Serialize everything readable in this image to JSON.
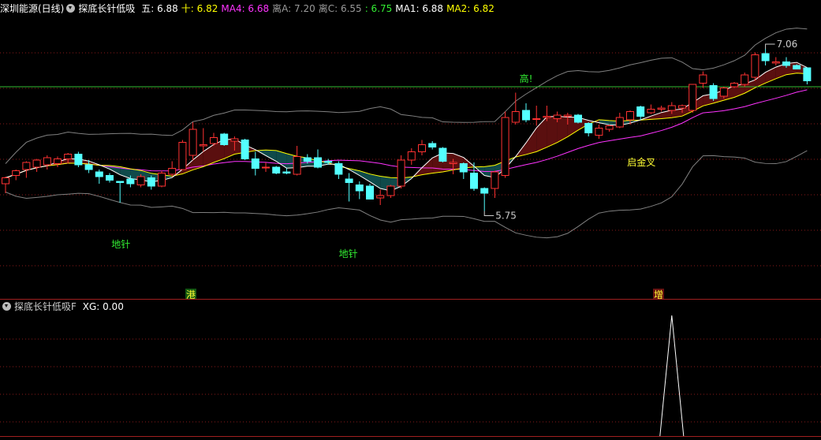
{
  "top_header": {
    "stock_title": "深圳能源(日线)",
    "indicator_name": "探底长针低吸",
    "items": [
      {
        "label": "五:",
        "value": "6.88",
        "color": "#ffffff"
      },
      {
        "label": "十:",
        "value": "6.82",
        "color": "#ffff00"
      },
      {
        "label": "MA4:",
        "value": "6.68",
        "color": "#ff33ff"
      },
      {
        "label": "离A:",
        "value": "7.20",
        "color": "#9a9a9a"
      },
      {
        "label": "离C:",
        "value": "6.55",
        "color": "#9a9a9a"
      },
      {
        "label": ":",
        "value": "6.75",
        "color": "#33ee33"
      },
      {
        "label": "MA1:",
        "value": "6.88",
        "color": "#ffffff"
      },
      {
        "label": "MA2:",
        "value": "6.82",
        "color": "#ffff00"
      }
    ]
  },
  "bottom_header": {
    "indicator_name": "探底长针低吸F",
    "items": [
      {
        "label": "XG:",
        "value": "0.00",
        "color": "#ffffff"
      }
    ]
  },
  "annotations": {
    "high_label": "高!",
    "low_signal_1": "地针",
    "low_signal_2": "地针",
    "golden_cross": "启金叉",
    "price_high": "7.06",
    "price_low": "5.75",
    "badge_1": "港",
    "badge_2": "增"
  },
  "colors": {
    "up": "#ff3232",
    "down": "#54ffff",
    "ma_white": "#ffffff",
    "ma_yellow": "#ffff00",
    "ma_magenta": "#ff33ff",
    "band": "#808080",
    "resistance": "#33bb33",
    "grid": "#8a1a1a",
    "ribbon_bear": "#5a0f0f",
    "ribbon_bull": "#0f4a4a"
  },
  "chart_data": {
    "type": "candlestick",
    "y_range": [
      5.0,
      7.3
    ],
    "resistance_level": 6.7,
    "candles": [
      {
        "o": 5.88,
        "h": 5.94,
        "l": 5.8,
        "c": 5.93
      },
      {
        "o": 5.95,
        "h": 6.0,
        "l": 5.91,
        "c": 5.99
      },
      {
        "o": 6.0,
        "h": 6.07,
        "l": 5.93,
        "c": 6.06
      },
      {
        "o": 6.02,
        "h": 6.09,
        "l": 5.98,
        "c": 6.08
      },
      {
        "o": 6.04,
        "h": 6.12,
        "l": 6.0,
        "c": 6.1
      },
      {
        "o": 6.05,
        "h": 6.11,
        "l": 6.02,
        "c": 6.09
      },
      {
        "o": 6.09,
        "h": 6.14,
        "l": 6.05,
        "c": 6.13
      },
      {
        "o": 6.13,
        "h": 6.15,
        "l": 6.02,
        "c": 6.04
      },
      {
        "o": 6.04,
        "h": 6.08,
        "l": 5.97,
        "c": 6.0
      },
      {
        "o": 5.98,
        "h": 6.0,
        "l": 5.88,
        "c": 5.94
      },
      {
        "o": 5.95,
        "h": 5.97,
        "l": 5.89,
        "c": 5.91
      },
      {
        "o": 5.9,
        "h": 5.9,
        "l": 5.72,
        "c": 5.89
      },
      {
        "o": 5.92,
        "h": 5.95,
        "l": 5.85,
        "c": 5.88
      },
      {
        "o": 5.87,
        "h": 5.96,
        "l": 5.85,
        "c": 5.94
      },
      {
        "o": 5.93,
        "h": 5.95,
        "l": 5.83,
        "c": 5.86
      },
      {
        "o": 5.86,
        "h": 5.99,
        "l": 5.85,
        "c": 5.97
      },
      {
        "o": 5.96,
        "h": 6.07,
        "l": 5.94,
        "c": 6.01
      },
      {
        "o": 6.0,
        "h": 6.25,
        "l": 6.0,
        "c": 6.23
      },
      {
        "o": 6.12,
        "h": 6.4,
        "l": 6.08,
        "c": 6.34
      },
      {
        "o": 6.2,
        "h": 6.35,
        "l": 6.15,
        "c": 6.21
      },
      {
        "o": 6.22,
        "h": 6.31,
        "l": 6.2,
        "c": 6.27
      },
      {
        "o": 6.3,
        "h": 6.31,
        "l": 6.2,
        "c": 6.21
      },
      {
        "o": 6.24,
        "h": 6.28,
        "l": 6.16,
        "c": 6.26
      },
      {
        "o": 6.25,
        "h": 6.26,
        "l": 6.08,
        "c": 6.09
      },
      {
        "o": 6.09,
        "h": 6.15,
        "l": 5.95,
        "c": 6.01
      },
      {
        "o": 6.02,
        "h": 6.06,
        "l": 5.98,
        "c": 6.02
      },
      {
        "o": 6.02,
        "h": 6.03,
        "l": 5.96,
        "c": 5.97
      },
      {
        "o": 5.98,
        "h": 6.01,
        "l": 5.96,
        "c": 5.97
      },
      {
        "o": 5.96,
        "h": 6.2,
        "l": 5.95,
        "c": 6.11
      },
      {
        "o": 6.1,
        "h": 6.13,
        "l": 6.05,
        "c": 6.07
      },
      {
        "o": 6.1,
        "h": 6.17,
        "l": 6.01,
        "c": 6.02
      },
      {
        "o": 6.07,
        "h": 6.09,
        "l": 6.04,
        "c": 6.06
      },
      {
        "o": 6.05,
        "h": 6.07,
        "l": 5.92,
        "c": 5.96
      },
      {
        "o": 5.92,
        "h": 5.97,
        "l": 5.73,
        "c": 5.89
      },
      {
        "o": 5.87,
        "h": 5.9,
        "l": 5.75,
        "c": 5.82
      },
      {
        "o": 5.86,
        "h": 5.88,
        "l": 5.75,
        "c": 5.75
      },
      {
        "o": 5.76,
        "h": 5.83,
        "l": 5.7,
        "c": 5.78
      },
      {
        "o": 5.78,
        "h": 5.87,
        "l": 5.76,
        "c": 5.86
      },
      {
        "o": 5.86,
        "h": 6.12,
        "l": 5.84,
        "c": 6.08
      },
      {
        "o": 6.08,
        "h": 6.18,
        "l": 6.04,
        "c": 6.15
      },
      {
        "o": 6.15,
        "h": 6.25,
        "l": 6.12,
        "c": 6.21
      },
      {
        "o": 6.22,
        "h": 6.24,
        "l": 6.17,
        "c": 6.19
      },
      {
        "o": 6.18,
        "h": 6.19,
        "l": 6.06,
        "c": 6.07
      },
      {
        "o": 6.05,
        "h": 6.09,
        "l": 5.96,
        "c": 6.06
      },
      {
        "o": 6.05,
        "h": 6.06,
        "l": 5.92,
        "c": 5.98
      },
      {
        "o": 5.97,
        "h": 6.06,
        "l": 5.82,
        "c": 5.84
      },
      {
        "o": 5.84,
        "h": 5.85,
        "l": 5.65,
        "c": 5.8
      },
      {
        "o": 5.84,
        "h": 5.99,
        "l": 5.76,
        "c": 5.98
      },
      {
        "o": 5.95,
        "h": 6.49,
        "l": 5.93,
        "c": 6.44
      },
      {
        "o": 6.4,
        "h": 6.65,
        "l": 6.38,
        "c": 6.49
      },
      {
        "o": 6.5,
        "h": 6.56,
        "l": 6.4,
        "c": 6.42
      },
      {
        "o": 6.43,
        "h": 6.54,
        "l": 6.37,
        "c": 6.43
      },
      {
        "o": 6.44,
        "h": 6.54,
        "l": 6.41,
        "c": 6.45
      },
      {
        "o": 6.43,
        "h": 6.49,
        "l": 6.4,
        "c": 6.46
      },
      {
        "o": 6.45,
        "h": 6.48,
        "l": 6.38,
        "c": 6.46
      },
      {
        "o": 6.46,
        "h": 6.47,
        "l": 6.39,
        "c": 6.4
      },
      {
        "o": 6.39,
        "h": 6.4,
        "l": 6.28,
        "c": 6.31
      },
      {
        "o": 6.29,
        "h": 6.38,
        "l": 6.26,
        "c": 6.35
      },
      {
        "o": 6.34,
        "h": 6.38,
        "l": 6.32,
        "c": 6.37
      },
      {
        "o": 6.36,
        "h": 6.48,
        "l": 6.35,
        "c": 6.44
      },
      {
        "o": 6.42,
        "h": 6.5,
        "l": 6.38,
        "c": 6.49
      },
      {
        "o": 6.53,
        "h": 6.54,
        "l": 6.42,
        "c": 6.45
      },
      {
        "o": 6.48,
        "h": 6.55,
        "l": 6.47,
        "c": 6.51
      },
      {
        "o": 6.51,
        "h": 6.54,
        "l": 6.49,
        "c": 6.52
      },
      {
        "o": 6.5,
        "h": 6.57,
        "l": 6.47,
        "c": 6.54
      },
      {
        "o": 6.52,
        "h": 6.55,
        "l": 6.48,
        "c": 6.54
      },
      {
        "o": 6.5,
        "h": 6.72,
        "l": 6.48,
        "c": 6.72
      },
      {
        "o": 6.73,
        "h": 6.83,
        "l": 6.69,
        "c": 6.8
      },
      {
        "o": 6.71,
        "h": 6.73,
        "l": 6.58,
        "c": 6.6
      },
      {
        "o": 6.62,
        "h": 6.7,
        "l": 6.6,
        "c": 6.69
      },
      {
        "o": 6.7,
        "h": 6.74,
        "l": 6.69,
        "c": 6.73
      },
      {
        "o": 6.72,
        "h": 6.82,
        "l": 6.7,
        "c": 6.8
      },
      {
        "o": 6.78,
        "h": 6.99,
        "l": 6.75,
        "c": 6.97
      },
      {
        "o": 6.98,
        "h": 7.02,
        "l": 6.88,
        "c": 6.92
      },
      {
        "o": 6.9,
        "h": 6.95,
        "l": 6.88,
        "c": 6.91
      },
      {
        "o": 6.91,
        "h": 6.95,
        "l": 6.86,
        "c": 6.88
      },
      {
        "o": 6.88,
        "h": 6.89,
        "l": 6.85,
        "c": 6.85
      },
      {
        "o": 6.86,
        "h": 6.86,
        "l": 6.72,
        "c": 6.75
      }
    ],
    "signal_spike": {
      "index": 64,
      "value": 1
    }
  }
}
